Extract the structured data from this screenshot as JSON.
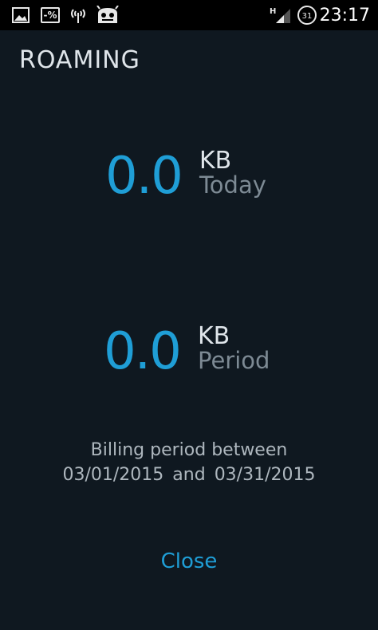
{
  "status_bar": {
    "time": "23:17",
    "network_type": "H",
    "calendar_day": "31",
    "percent_badge": "-%",
    "icons": [
      "gallery-icon",
      "percent-icon",
      "wireless-signal-icon",
      "cyanogenmod-icon",
      "mobile-signal-icon",
      "calendar-icon"
    ]
  },
  "screen": {
    "title": "ROAMING",
    "today": {
      "value": "0.0",
      "unit": "KB",
      "label": "Today"
    },
    "period": {
      "value": "0.0",
      "unit": "KB",
      "label": "Period"
    },
    "billing": {
      "line1": "Billing period between",
      "start": "03/01/2015",
      "connector": "and",
      "end": "03/31/2015"
    },
    "close_label": "Close"
  },
  "colors": {
    "background": "#0f1820",
    "accent": "#1f9ed6",
    "muted": "#7d8a94"
  }
}
